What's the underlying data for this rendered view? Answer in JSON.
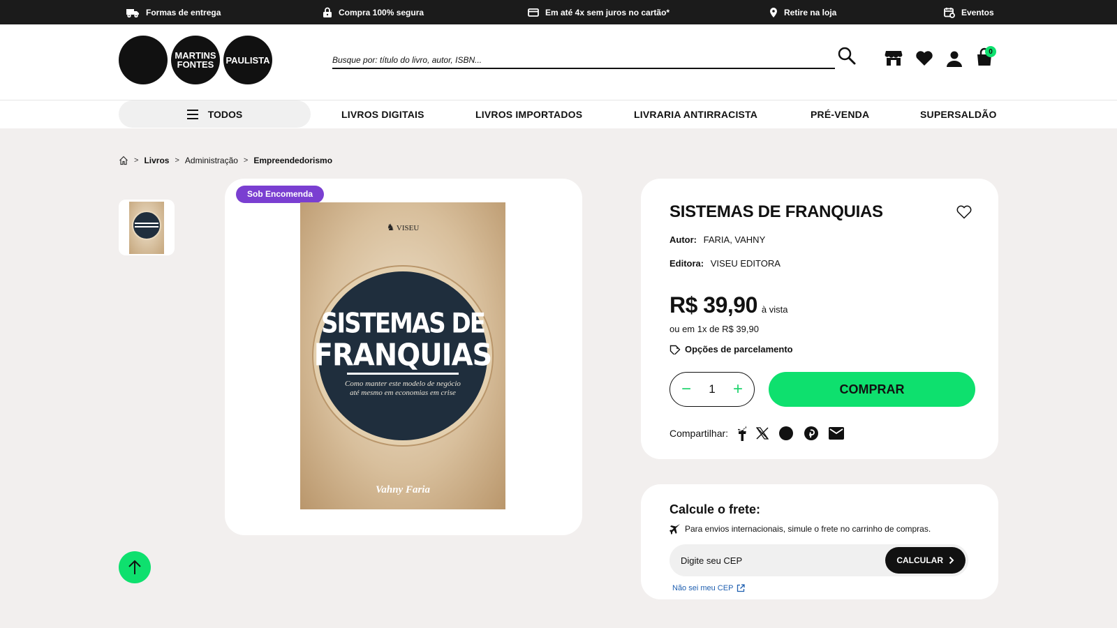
{
  "topbar": {
    "items": [
      {
        "label": "Formas de entrega",
        "icon": "truck-icon"
      },
      {
        "label": "Compra 100% segura",
        "icon": "lock-icon"
      },
      {
        "label": "Em até 4x sem juros no cartão*",
        "icon": "credit-card-icon"
      },
      {
        "label": "Retire na loja",
        "icon": "map-pin-icon"
      },
      {
        "label": "Eventos",
        "icon": "calendar-icon"
      }
    ]
  },
  "header": {
    "logo": [
      "",
      "MARTINS\nFONTES",
      "PAULISTA"
    ],
    "search_placeholder": "Busque por: título do livro, autor, ISBN...",
    "cart_count": "0"
  },
  "nav": {
    "todos": "TODOS",
    "links": [
      "LIVROS DIGITAIS",
      "LIVROS IMPORTADOS",
      "LIVRARIA ANTIRRACISTA",
      "PRÉ-VENDA",
      "SUPERSALDÃO"
    ]
  },
  "breadcrumb": [
    "Livros",
    "Administração",
    "Empreendedorismo"
  ],
  "product": {
    "badge": "Sob Encomenda",
    "cover": {
      "publisher": "VISEU",
      "title_line1": "SISTEMAS DE",
      "title_line2": "FRANQUIAS",
      "subtitle_line1": "Como manter este modelo de negócio",
      "subtitle_line2": "até mesmo em economias em crise",
      "author": "Vahny Faria"
    },
    "title": "SISTEMAS DE FRANQUIAS",
    "author_label": "Autor:",
    "author": "FARIA, VAHNY",
    "publisher_label": "Editora:",
    "publisher": "VISEU EDITORA",
    "price": "R$ 39,90",
    "price_suffix": "à vista",
    "installments": "ou em 1x de R$ 39,90",
    "parcel_options": "Opções de parcelamento",
    "quantity": "1",
    "buy_label": "COMPRAR",
    "share_label": "Compartilhar:"
  },
  "shipping": {
    "title": "Calcule o frete:",
    "note": "Para envios internacionais, simule o frete no carrinho de compras.",
    "cep_placeholder": "Digite seu CEP",
    "calc_label": "CALCULAR",
    "cep_link": "Não sei meu CEP"
  },
  "colors": {
    "accent_green": "#0ee06e",
    "badge_purple": "#7a3fd1",
    "dark": "#1b1b1b",
    "page_bg": "#f2efee"
  }
}
